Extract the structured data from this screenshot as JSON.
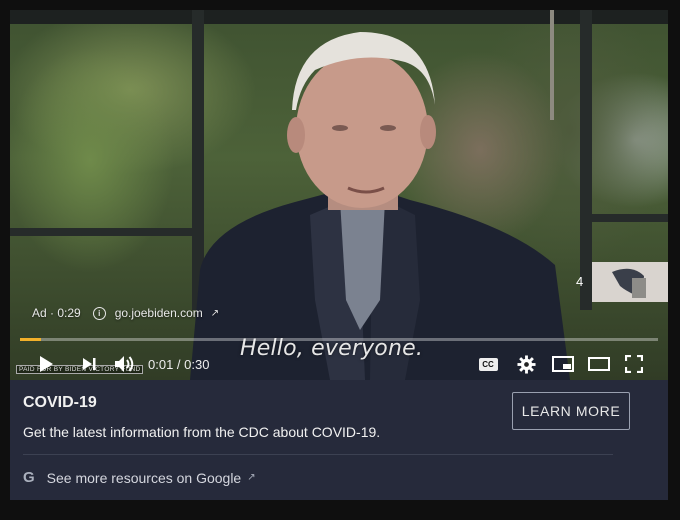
{
  "ad": {
    "label": "Ad · 0:29",
    "domain": "go.joebiden.com",
    "paid_for": "PAID FOR BY BIDEN VICTORY FUND"
  },
  "video": {
    "subtitle": "Hello, everyone.",
    "time_display": "0:01 / 0:30",
    "progress": 0.033,
    "skip_countdown": "4"
  },
  "icons": {
    "play": "play-icon",
    "next": "next-icon",
    "volume": "volume-icon",
    "cc": "CC",
    "settings": "gear-icon",
    "miniplayer": "miniplayer-icon",
    "theater": "theater-icon",
    "fullscreen": "fullscreen-icon"
  },
  "card": {
    "title": "COVID-19",
    "description": "Get the latest information from the CDC about COVID-19.",
    "cta": "LEARN MORE",
    "resources_g": "G",
    "resources_link": "See more resources on Google"
  },
  "colors": {
    "progress": "#f2b02a",
    "card_bg": "#262a3b"
  }
}
